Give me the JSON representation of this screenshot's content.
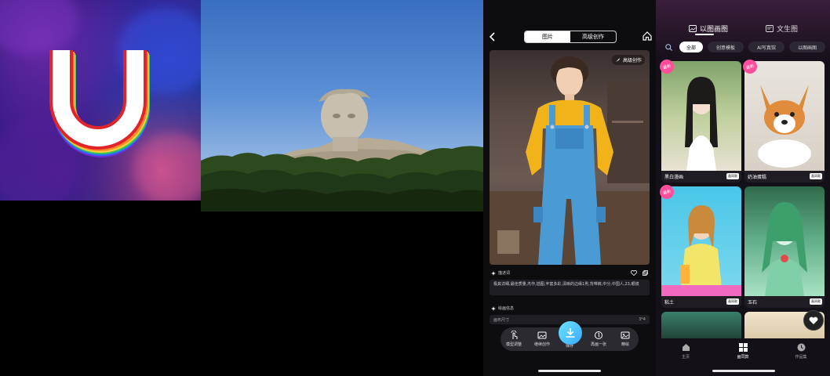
{
  "logo_panel": {
    "letter": "U"
  },
  "detail_screen": {
    "segment": {
      "tab_image": "图片",
      "tab_advanced": "高级创作"
    },
    "hero_overlay_button": "高级创作",
    "prompt_section_label": "描述词",
    "prompt_text": "极其详细,最佳质量,杰作,插图,丰富多彩,清晰的边缘1男,背带裤,中分,中国人,23,眼镜",
    "params_section_label": "绘画信息",
    "param_size_label": "画布尺寸",
    "param_size_value": "3*4",
    "toolbar": {
      "fine_tune": "模型调整",
      "continue": "继续创作",
      "save": "保存",
      "redraw": "再画一张",
      "hd": "精绘"
    }
  },
  "gallery_screen": {
    "tabs": {
      "img2img": "以图画图",
      "txt2img": "文生图"
    },
    "chips": [
      "全部",
      "创意模板",
      "AI写真馆",
      "以图画图"
    ],
    "cards": [
      {
        "caption": "黑白漫画",
        "tag": "画同款",
        "badge": "最新"
      },
      {
        "caption": "奶油蛋糕",
        "tag": "画同款",
        "badge": "最新"
      },
      {
        "caption": "粘土",
        "tag": "画同款",
        "badge": "最新"
      },
      {
        "caption": "玉石",
        "tag": "画同款",
        "badge": ""
      }
    ],
    "nav": {
      "home": "主页",
      "same": "画同款",
      "works": "作品集"
    }
  },
  "colors": {
    "accent_cyan": "#3aa9ff",
    "badge_pink": "#ff4e9c",
    "dark_bg": "#0d0d10"
  }
}
